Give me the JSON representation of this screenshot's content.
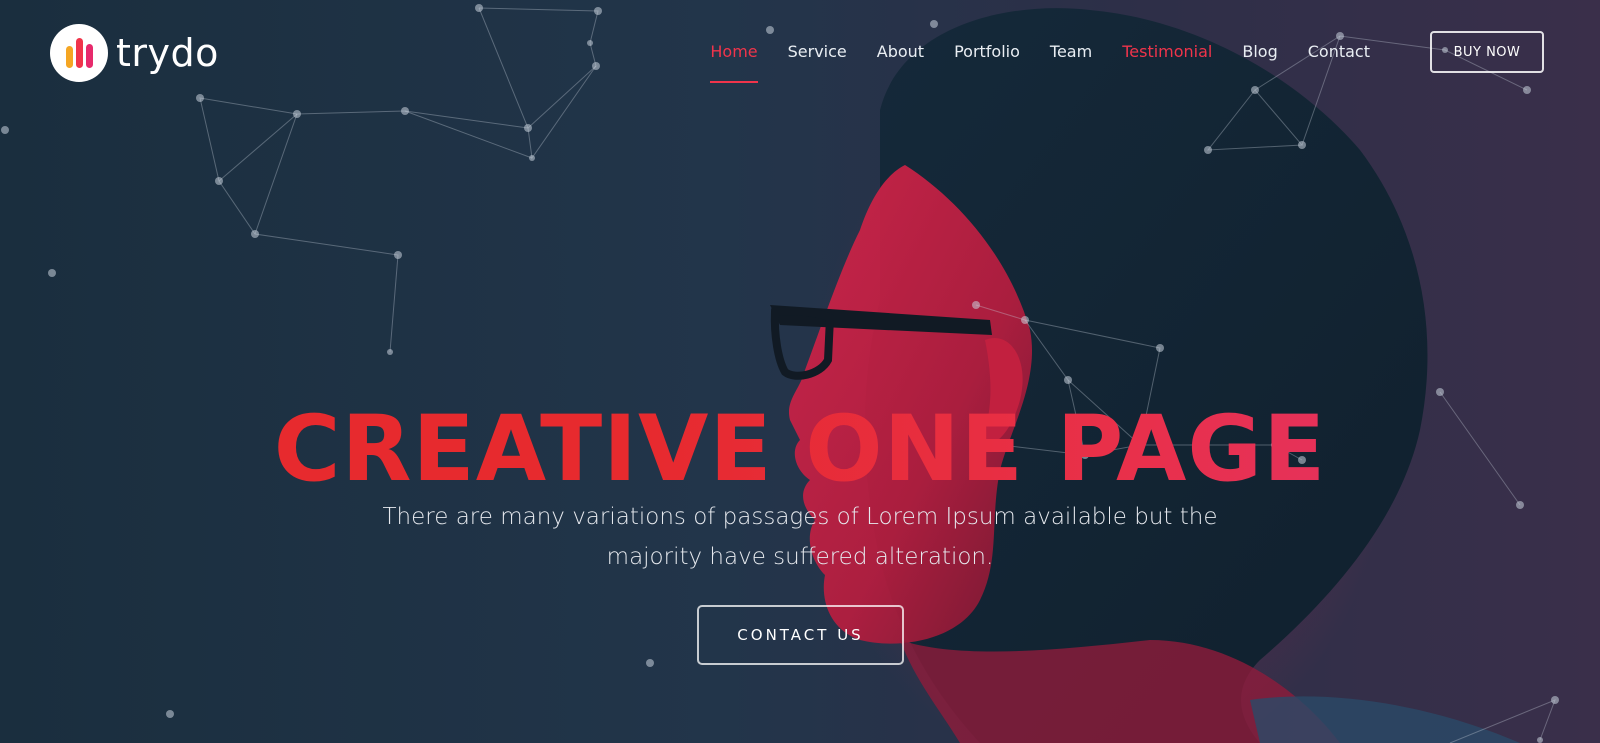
{
  "brand": {
    "name": "trydo",
    "logo_colors": [
      "#f5a623",
      "#f0344b",
      "#e72a6c"
    ]
  },
  "nav": {
    "items": [
      {
        "label": "Home",
        "state": "active"
      },
      {
        "label": "Service",
        "state": "normal"
      },
      {
        "label": "About",
        "state": "normal"
      },
      {
        "label": "Portfolio",
        "state": "normal"
      },
      {
        "label": "Team",
        "state": "normal"
      },
      {
        "label": "Testimonial",
        "state": "highlighted"
      },
      {
        "label": "Blog",
        "state": "normal"
      },
      {
        "label": "Contact",
        "state": "normal"
      }
    ],
    "buy_label": "BUY NOW"
  },
  "hero": {
    "title": "CREATIVE ONE PAGE",
    "description": "There are many variations of passages of Lorem Ipsum available but the majority have suffered alteration.",
    "cta_label": "CONTACT US"
  },
  "colors": {
    "accent": "#f0344b",
    "headline_red": "#e72a2e",
    "headline_pink": "#e3336e",
    "text": "#ffffff"
  },
  "icons": {
    "logo": "bars-logo-icon"
  }
}
